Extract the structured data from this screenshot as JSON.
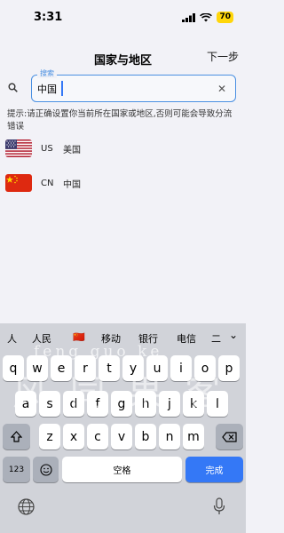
{
  "status": {
    "time": "3:31",
    "battery": "70"
  },
  "nav": {
    "title": "国家与地区",
    "next": "下一步"
  },
  "search": {
    "label": "搜索",
    "value": "中国"
  },
  "hint": "提示:请正确设置你当前所在国家或地区,否则可能会导致分流错误",
  "countries": [
    {
      "code": "US",
      "name": "美国",
      "flag": "us-flag"
    },
    {
      "code": "CN",
      "name": "中国",
      "flag": "cn-flag"
    }
  ],
  "keyboard": {
    "candidates": [
      "人",
      "人民",
      "🇨🇳",
      "移动",
      "银行",
      "电信",
      "二"
    ],
    "row1": [
      "q",
      "w",
      "e",
      "r",
      "t",
      "y",
      "u",
      "i",
      "o",
      "p"
    ],
    "row2": [
      "a",
      "s",
      "d",
      "f",
      "g",
      "h",
      "j",
      "k",
      "l"
    ],
    "row3": [
      "z",
      "x",
      "c",
      "v",
      "b",
      "n",
      "m"
    ],
    "numbers_key": "123",
    "space_label": "空格",
    "done_label": "完成"
  },
  "watermark": {
    "text_top": "feng guo ke",
    "text_main": "风 同 果 客"
  }
}
